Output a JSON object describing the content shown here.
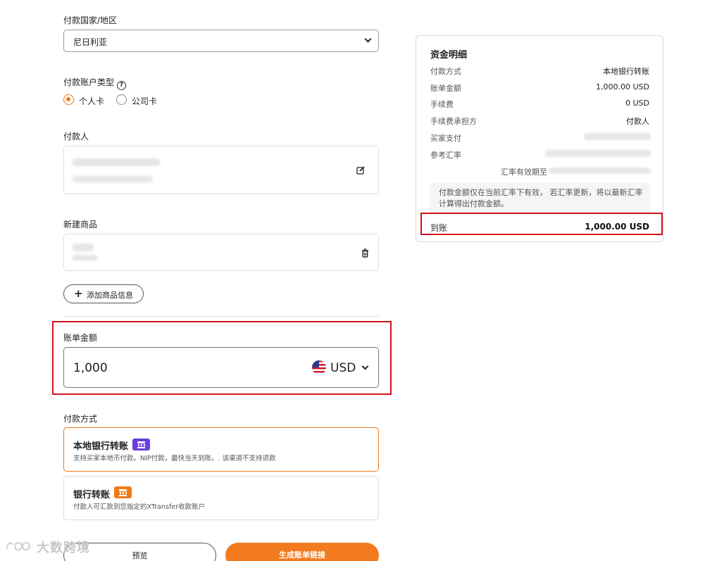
{
  "form": {
    "country": {
      "label": "付款国家/地区",
      "value": "尼日利亚"
    },
    "account_type": {
      "label": "付款账户类型",
      "help_glyph": "?",
      "options": [
        "个人卡",
        "公司卡"
      ],
      "selected": "个人卡"
    },
    "payer": {
      "label": "付款人"
    },
    "product": {
      "label": "新建商品",
      "add_button": "添加商品信息",
      "add_glyph": "+"
    },
    "amount": {
      "label": "账单金额",
      "value": "1,000",
      "currency": "USD"
    },
    "payment_method": {
      "label": "付款方式",
      "options": [
        {
          "title": "本地银行转账",
          "desc": "支持买家本地币付款。NIP付款，最快当天到账。. 该渠道不支持退款",
          "badge_color": "#6a3ee0",
          "selected": true
        },
        {
          "title": "银行转账",
          "desc": "付款人可汇款到您指定的XTransfer收款账户",
          "badge_color": "#f07a1a",
          "selected": false
        }
      ]
    },
    "buttons": {
      "preview": "预览",
      "generate": "生成账单链接"
    }
  },
  "summary": {
    "title": "资金明细",
    "rows": [
      {
        "label": "付款方式",
        "value": "本地银行转账"
      },
      {
        "label": "账单金额",
        "value": "1,000.00 USD"
      },
      {
        "label": "手续费",
        "value": "0 USD"
      },
      {
        "label": "手续费承担方",
        "value": "付款人"
      },
      {
        "label": "买家支付",
        "value": ""
      },
      {
        "label": "参考汇率",
        "value": ""
      }
    ],
    "rate_validity_label": "汇率有效期至",
    "notice": "付款金额仅在当前汇率下有效， 若汇率更新，将以最新汇率计算得出付款金额。",
    "received_label": "到账",
    "received_value": "1,000.00 USD"
  },
  "watermark": {
    "text": "大数跨境"
  },
  "colors": {
    "accent": "#f37a1f",
    "highlight_border": "#d0121b",
    "bank_badge_purple": "#6a3ee0",
    "bank_badge_orange": "#f07a1a"
  },
  "icons": {
    "country_dropdown": "chevron-down-icon",
    "account_help": "help-circle-icon",
    "payer_edit": "edit-icon",
    "product_delete": "trash-icon",
    "add_product": "plus-icon",
    "currency_flag": "us-flag-icon",
    "currency_dropdown": "chevron-down-icon",
    "local_bank": "bank-icon",
    "bank_transfer": "bank-icon",
    "watermark_logo": "watermark-logo-icon"
  }
}
